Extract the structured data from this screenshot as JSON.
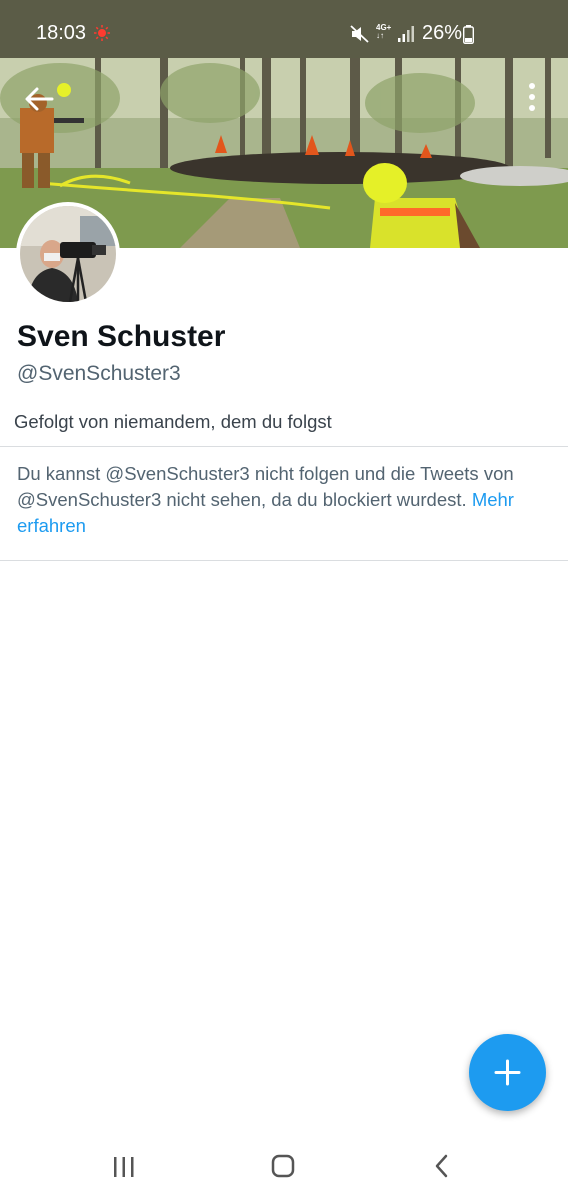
{
  "status_bar": {
    "time": "18:03",
    "network": "4G+",
    "battery": "26%",
    "icons": [
      "recording-icon",
      "mute-icon",
      "network-4g-icon",
      "signal-icon",
      "battery-icon"
    ]
  },
  "profile": {
    "display_name": "Sven Schuster",
    "handle": "@SvenSchuster3",
    "followers_note": "Gefolgt von niemandem, dem du folgst",
    "header_image": "firefighters extinguishing a forest fire",
    "avatar_image": "person with a video camera"
  },
  "blocked_notice": {
    "text": "Du kannst @SvenSchuster3 nicht folgen und die Tweets von @SvenSchuster3 nicht sehen, da du blockiert wurdest.",
    "link": "Mehr erfahren"
  },
  "actions": {
    "back": "back-arrow-icon",
    "more": "more-vertical-icon",
    "compose": "plus-icon"
  },
  "nav_bar": [
    "recents-icon",
    "home-icon",
    "back-icon"
  ],
  "colors": {
    "status_bar": "#5b5c47",
    "accent": "#1d9bf0",
    "text_primary": "#0f1419",
    "text_secondary": "#536471"
  }
}
